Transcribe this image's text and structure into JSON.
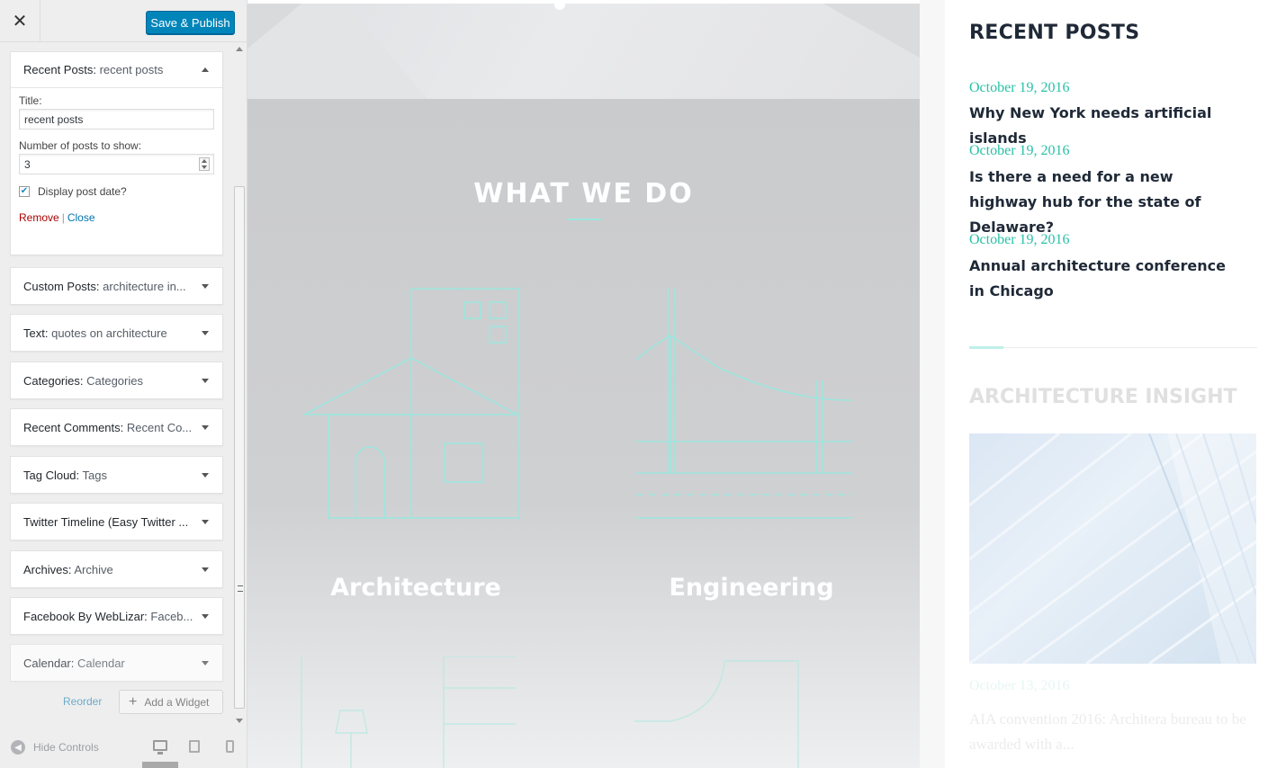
{
  "customizer": {
    "close_glyph": "✕",
    "publish_label": "Save & Publish",
    "widgets": {
      "recent": {
        "type": "Recent Posts:",
        "sub": "recent posts",
        "title_label": "Title:",
        "title_value": "recent posts",
        "number_label": "Number of posts to show:",
        "number_value": "3",
        "checkbox_label": "Display post date?",
        "checkbox_checked": true,
        "remove_label": "Remove",
        "separator": "|",
        "close_label": "Close"
      },
      "custom": {
        "type": "Custom Posts:",
        "sub": "architecture in..."
      },
      "text": {
        "type": "Text:",
        "sub": "quotes on architecture"
      },
      "cats": {
        "type": "Categories:",
        "sub": "Categories"
      },
      "comments": {
        "type": "Recent Comments:",
        "sub": "Recent Co..."
      },
      "tags": {
        "type": "Tag Cloud:",
        "sub": "Tags"
      },
      "twitter": {
        "type": "Twitter Timeline (Easy Twitter ...",
        "sub": ""
      },
      "archives": {
        "type": "Archives:",
        "sub": "Archive"
      },
      "facebook": {
        "type": "Facebook By WebLizar:",
        "sub": "Faceb..."
      },
      "calendar": {
        "type": "Calendar:",
        "sub": "Calendar"
      }
    },
    "reorder_label": "Reorder",
    "add_widget_label": "Add a Widget",
    "hide_controls_label": "Hide Controls"
  },
  "preview": {
    "section_title": "WHAT WE DO",
    "services": [
      "Architecture",
      "Engineering"
    ]
  },
  "sidebar_right": {
    "recent_heading": "RECENT POSTS",
    "posts": [
      {
        "date": "October 19, 2016",
        "title": "Why New York needs artificial islands"
      },
      {
        "date": "October 19, 2016",
        "title": "Is there a need for a new highway hub for the state of Delaware?"
      },
      {
        "date": "October 19, 2016",
        "title": "Annual architecture conference in Chicago"
      }
    ],
    "insight_heading": "ARCHITECTURE INSIGHT",
    "insight_date": "October 13, 2016",
    "insight_title": "AIA convention 2016: Architera bureau to be awarded with a..."
  },
  "colors": {
    "publish_bg": "#0085ba",
    "accent_teal": "#28c1a6",
    "heading_dark": "#1f2937",
    "line_art": "#9ee6de"
  }
}
